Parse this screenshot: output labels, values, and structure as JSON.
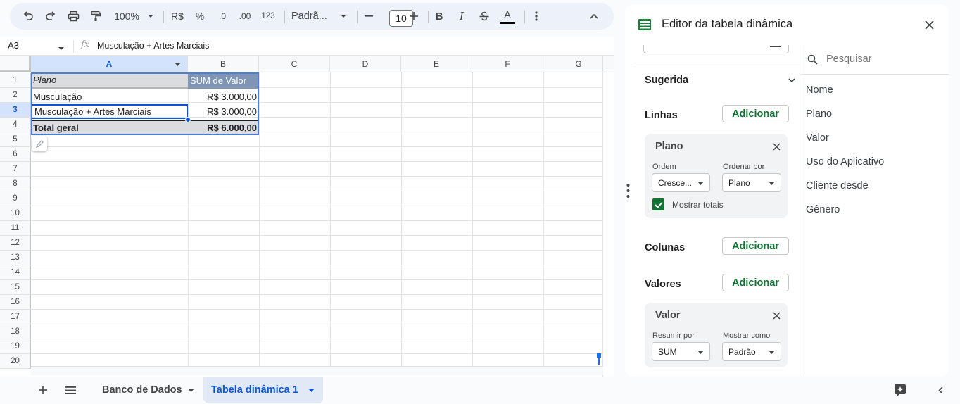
{
  "toolbar": {
    "zoom": "100%",
    "currency": "R$",
    "percent": "%",
    "decrease_decimals": ".0",
    "increase_decimals": ".00",
    "number_format": "123",
    "font": "Padrã...",
    "font_size": "10",
    "text_color": "#000000"
  },
  "formula_bar": {
    "cell_ref": "A3",
    "fx": "fx",
    "formula": "Musculação + Artes Marciais"
  },
  "grid": {
    "columns": [
      "A",
      "B",
      "C",
      "D",
      "E",
      "F",
      "G"
    ],
    "rows": [
      "1",
      "2",
      "3",
      "4",
      "5",
      "6",
      "7",
      "8",
      "9",
      "10",
      "11",
      "12",
      "13",
      "14",
      "15",
      "16",
      "17",
      "18",
      "19",
      "20"
    ],
    "selected_column": "A",
    "selected_row": "3",
    "cells": {
      "a1": "Plano",
      "b1": "SUM de Valor",
      "a2": "Musculação",
      "b2": "R$ 3.000,00",
      "a3": "Musculação + Artes Marciais",
      "b3": "R$ 3.000,00",
      "a4": "Total geral",
      "b4": "R$ 6.000,00"
    }
  },
  "sheets": {
    "tabs": [
      "Banco de Dados",
      "Tabela dinâmica 1"
    ],
    "active": "Tabela dinâmica 1"
  },
  "pivot_editor": {
    "title": "Editor da tabela dinâmica",
    "suggested_label": "Sugerida",
    "rows_label": "Linhas",
    "columns_label": "Colunas",
    "values_label": "Valores",
    "add_label": "Adicionar",
    "rows_card": {
      "title": "Plano",
      "order_label": "Ordem",
      "order_value": "Cresce...",
      "sort_by_label": "Ordenar por",
      "sort_by_value": "Plano",
      "show_totals_label": "Mostrar totais",
      "show_totals_checked": true
    },
    "values_card": {
      "title": "Valor",
      "summarize_label": "Resumir por",
      "summarize_value": "SUM",
      "show_as_label": "Mostrar como",
      "show_as_value": "Padrão"
    },
    "search_placeholder": "Pesquisar",
    "fields": [
      "Nome",
      "Plano",
      "Valor",
      "Uso do Aplicativo",
      "Cliente desde",
      "Gênero"
    ]
  },
  "colors": {
    "accent_blue": "#0b57d0",
    "pivot_header": "#8095b3",
    "add_green": "#137333",
    "sheets_icon_green": "#188038"
  }
}
